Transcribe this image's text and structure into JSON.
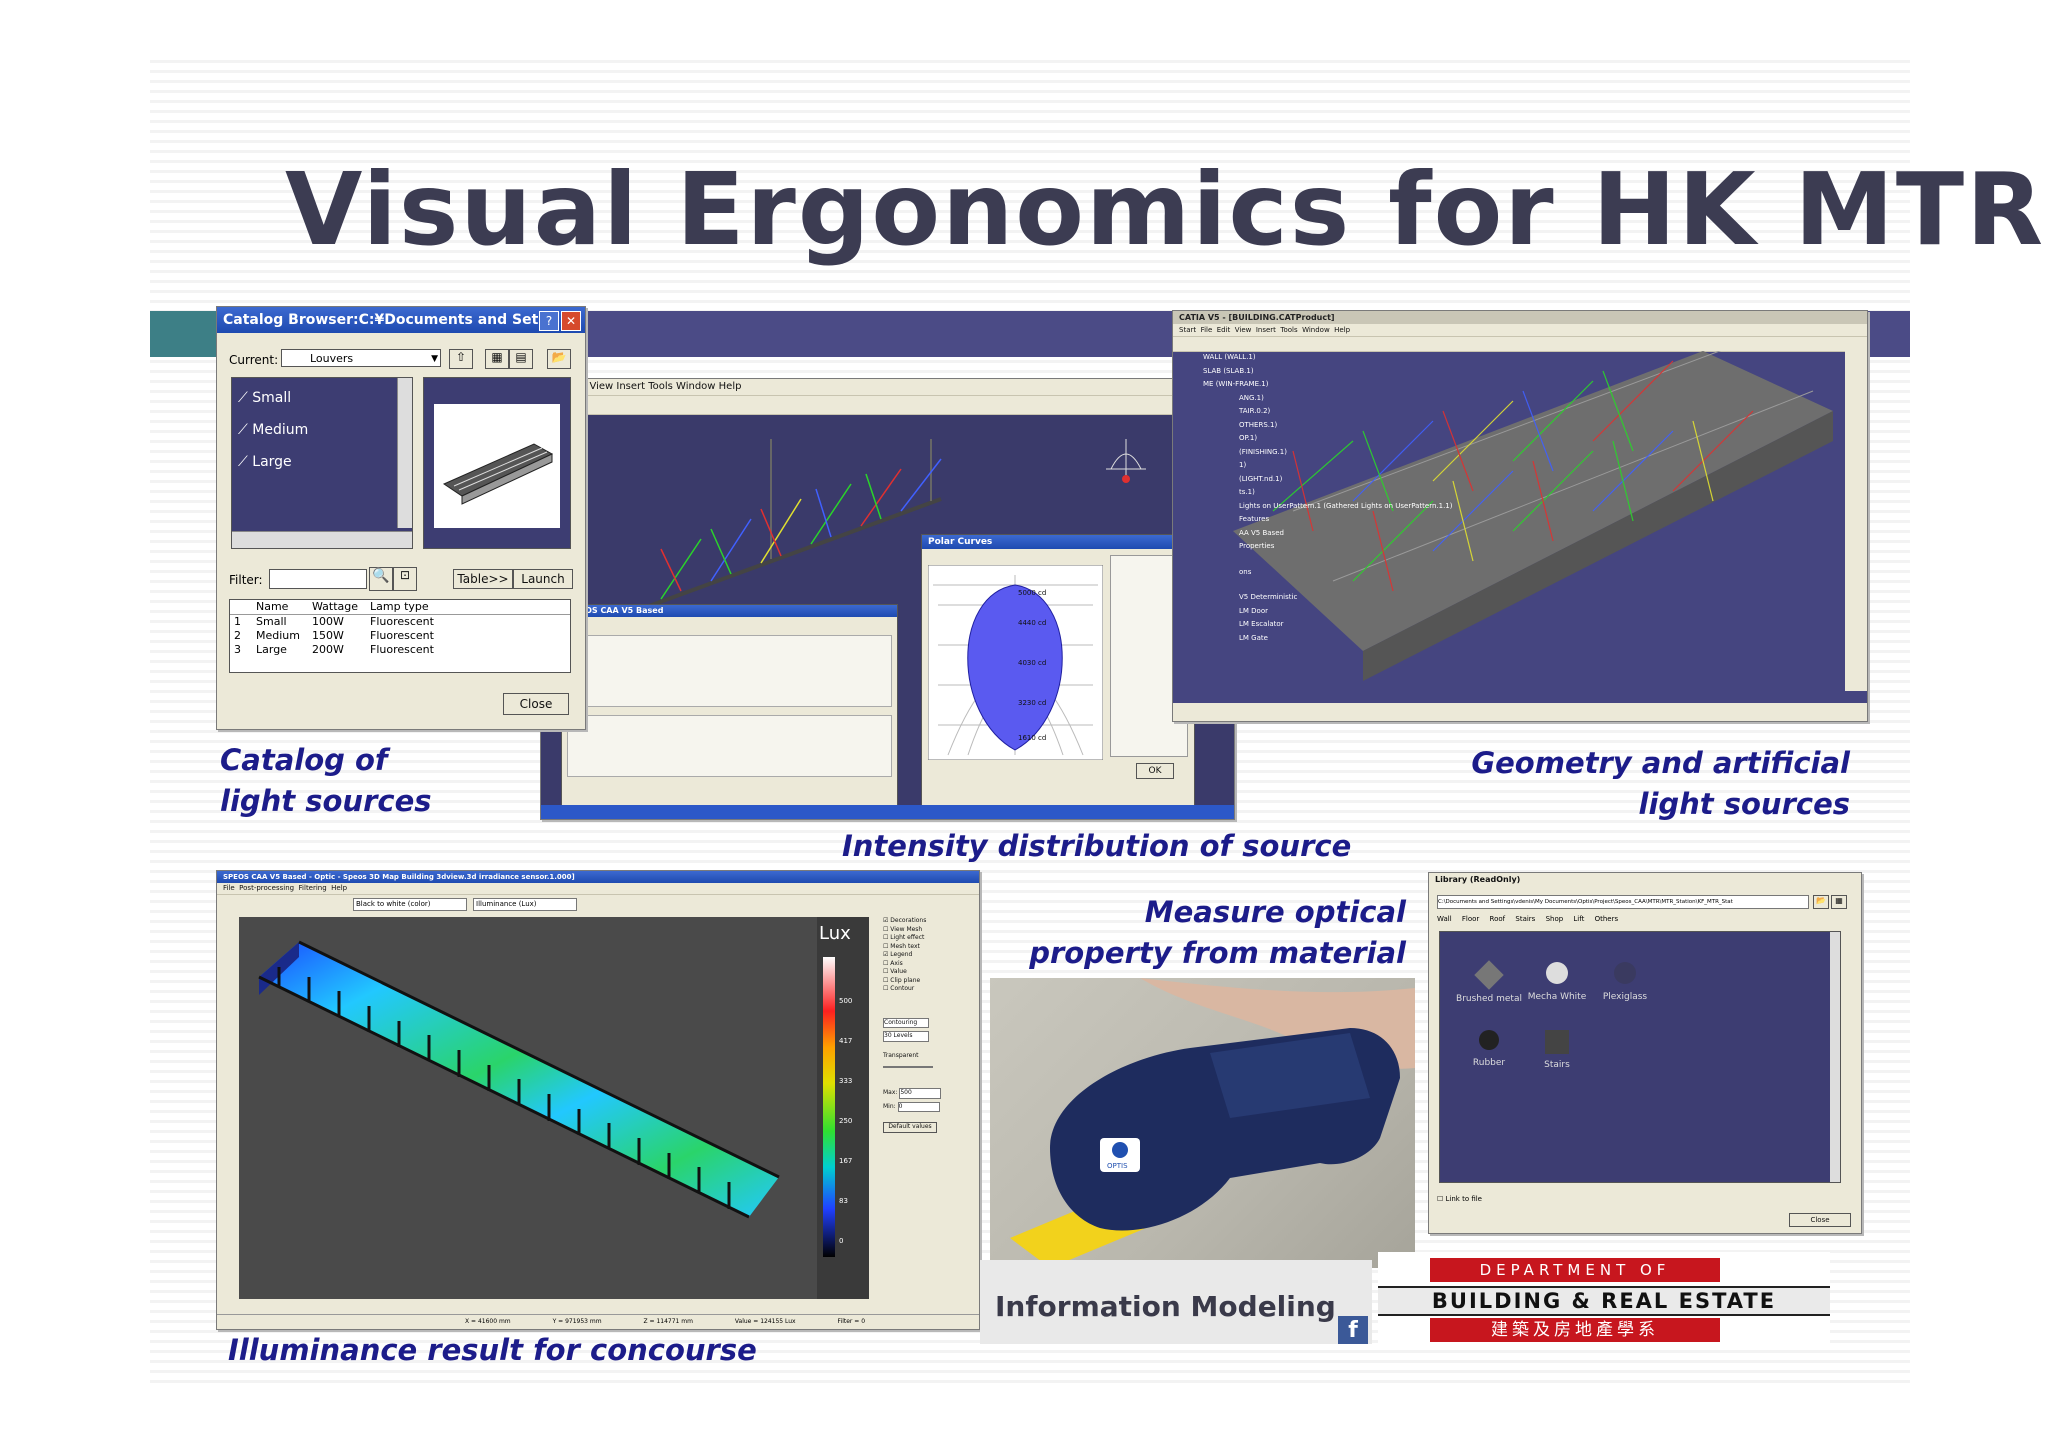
{
  "slide": {
    "title": "Visual Ergonomics for HK MTR",
    "colors": {
      "band": "#4b4b86",
      "band_accent": "#3d7f86",
      "title": "#3c3c52",
      "caption": "#1c1c8a"
    }
  },
  "captions": {
    "catalog": "Catalog of light sources",
    "intensity": "Intensity distribution of source",
    "geometry": "Geometry and artificial light sources",
    "measure": "Measure optical property from material",
    "illuminance": "Illuminance result for concourse",
    "bim": "Information Modeling"
  },
  "catalog_window": {
    "title": "Catalog Browser:C:¥Documents and Set...",
    "current_label": "Current:",
    "current_value": "Louvers",
    "tree_items": [
      "Small",
      "Medium",
      "Large"
    ],
    "filter_label": "Filter:",
    "table_button": "Table>>",
    "launch_button": "Launch",
    "close_button": "Close",
    "columns": [
      "Name",
      "Wattage",
      "Lamp type"
    ],
    "rows": [
      [
        "1",
        "Small",
        "100W",
        "Fluorescent"
      ],
      [
        "2",
        "Medium",
        "150W",
        "Fluorescent"
      ],
      [
        "3",
        "Large",
        "200W",
        "Fluorescent"
      ]
    ]
  },
  "polar_window": {
    "title": "Polar Curves",
    "labels": [
      "5000 cd",
      "4440 cd",
      "4030 cd",
      "3230 cd",
      "1610 cd"
    ],
    "ok_button": "OK"
  },
  "catia_window": {
    "title": "CATIA V5 - [BUILDING.CATProduct]",
    "menu": [
      "Start",
      "File",
      "Edit",
      "View",
      "Insert",
      "Tools",
      "Window",
      "Help"
    ],
    "tree": [
      "WALL (WALL.1)",
      "SLAB (SLAB.1)",
      "ME (WIN-FRAME.1)",
      "ANG.1)",
      "TAIR.0.2)",
      "OTHERS.1)",
      "OP.1)",
      "(FINISHING.1)",
      "1)",
      "(LIGHT.nd.1)",
      "ts.1)",
      "Lights on UserPattern.1 (Gathered Lights on UserPattern.1.1)",
      "Features",
      "AA V5 Based",
      "Properties",
      "ons",
      "V5 Deterministic",
      "LM Door",
      "LM Escalator",
      "LM Gate"
    ]
  },
  "speos_window": {
    "title": "SPEOS CAA V5 Based - Optic - Speos 3D Map Building 3dview.3d irradiance sensor.1.000]",
    "menu": [
      "File",
      "Post-processing",
      "Filtering",
      "Help"
    ],
    "palette_select": "Black to white (color)",
    "unit_select": "Illuminance (Lux)",
    "legend_unit": "Lux",
    "legend_ticks": [
      "500",
      "417",
      "333",
      "250",
      "167",
      "83",
      "0"
    ],
    "display_options": [
      "Decorations",
      "View Mesh",
      "Light effect",
      "Mesh text",
      "Legend",
      "Axis",
      "Value",
      "Clip plane",
      "Contour"
    ],
    "contouring": "Contouring",
    "levels": "30 Levels",
    "transparent": "Transparent",
    "max_label": "Max:",
    "max_value": "500",
    "min_label": "Min:",
    "min_value": "0",
    "default_values": "Default values",
    "status": [
      "X = 41600 mm",
      "Y = 971953 mm",
      "Z = 114771 mm",
      "Value = 124155 Lux",
      "Filter = 0"
    ]
  },
  "library_window": {
    "title": "Library (ReadOnly)",
    "path": "C:\\Documents and Settings\\vdenis\\My Documents\\Optis\\Project\\Speos_CAA\\MTR\\MTR_Station\\KF_MTR_Stat",
    "tabs": [
      "Wall",
      "Floor",
      "Roof",
      "Stairs",
      "Shop",
      "Lift",
      "Others"
    ],
    "materials": [
      "Brushed metal",
      "Mecha White",
      "Plexiglass",
      "Rubber",
      "Stairs"
    ],
    "link_label": "Link to file",
    "close_button": "Close"
  },
  "logo": {
    "line1": "DEPARTMENT OF",
    "line2": "BUILDING & REAL ESTATE",
    "line3": "建築及房地產學系"
  },
  "photo": {
    "device_brand": "OPTIS"
  }
}
